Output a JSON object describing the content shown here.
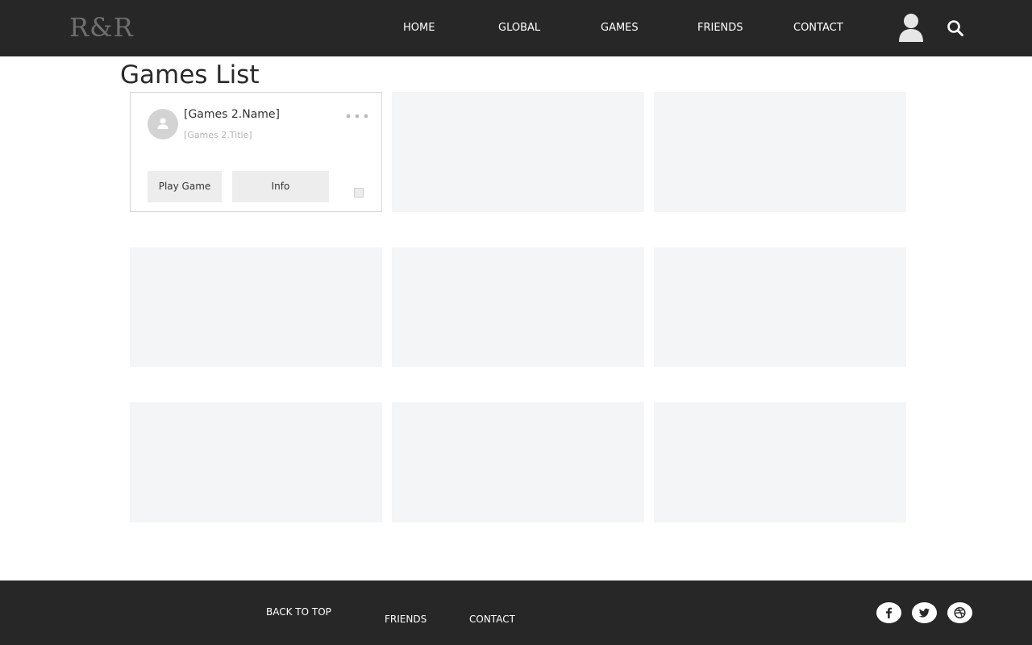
{
  "header": {
    "logo": "R&R",
    "nav": [
      {
        "label": "HOME"
      },
      {
        "label": "GLOBAL"
      },
      {
        "label": "GAMES"
      },
      {
        "label": "FRIENDS"
      },
      {
        "label": "CONTACT"
      }
    ],
    "icons": {
      "user": "user-icon",
      "search": "search-icon"
    }
  },
  "main": {
    "title": "Games List",
    "card": {
      "name": "[Games 2.Name]",
      "title": "[Games 2.Title]",
      "play_label": "Play Game",
      "info_label": "Info",
      "checked": false
    }
  },
  "footer": {
    "back_to_top": "BACK TO TOP",
    "friends": "FRIENDS",
    "contact": "CONTACT",
    "social": [
      "facebook-icon",
      "twitter-icon",
      "dribbble-icon"
    ]
  },
  "colors": {
    "header_bg": "#272727",
    "placeholder_tile": "#f4f5f7",
    "footer_bg": "#272727"
  }
}
